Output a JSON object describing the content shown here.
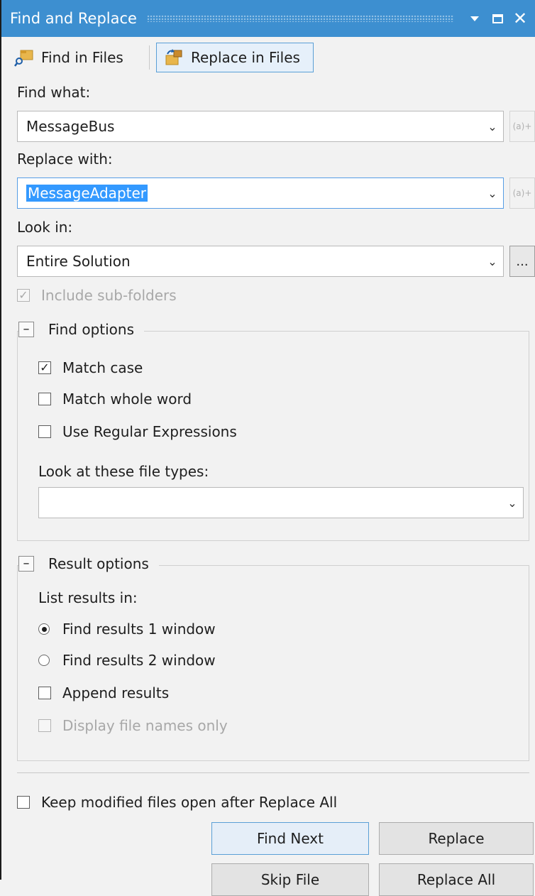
{
  "window": {
    "title": "Find and Replace",
    "icons": [
      "dropdown-arrow-icon",
      "maximize-icon",
      "close-icon"
    ]
  },
  "modes": {
    "find_in_files": "Find in Files",
    "replace_in_files": "Replace in Files",
    "selected": "Replace in Files"
  },
  "find": {
    "label": "Find what:",
    "value": "MessageBus",
    "regex_builder": "(a)+"
  },
  "replace": {
    "label": "Replace with:",
    "value": "MessageAdapter",
    "regex_builder": "(a)+"
  },
  "look_in": {
    "label": "Look in:",
    "value": "Entire Solution",
    "browse": "...",
    "include_subfolders": "Include sub-folders",
    "include_subfolders_checked": true
  },
  "find_options": {
    "title": "Find options",
    "toggle": "–",
    "match_case": "Match case",
    "match_case_checked": true,
    "match_whole_word": "Match whole word",
    "match_whole_word_checked": false,
    "use_regex": "Use Regular Expressions",
    "use_regex_checked": false,
    "file_types_label": "Look at these file types:",
    "file_types_value": ""
  },
  "result_options": {
    "title": "Result options",
    "toggle": "–",
    "list_results_label": "List results in:",
    "window1": "Find results 1 window",
    "window2": "Find results 2 window",
    "selected": "Find results 1 window",
    "append_results": "Append results",
    "append_results_checked": false,
    "display_file_names_only": "Display file names only",
    "display_file_names_only_checked": false
  },
  "keep_modified": {
    "label": "Keep modified files open after Replace All",
    "checked": false
  },
  "buttons": {
    "find_next": "Find Next",
    "replace": "Replace",
    "skip_file": "Skip File",
    "replace_all": "Replace All"
  },
  "colors": {
    "title_bar": "#3d8fd0",
    "selection": "#3399ff",
    "focus_border": "#569de5"
  }
}
